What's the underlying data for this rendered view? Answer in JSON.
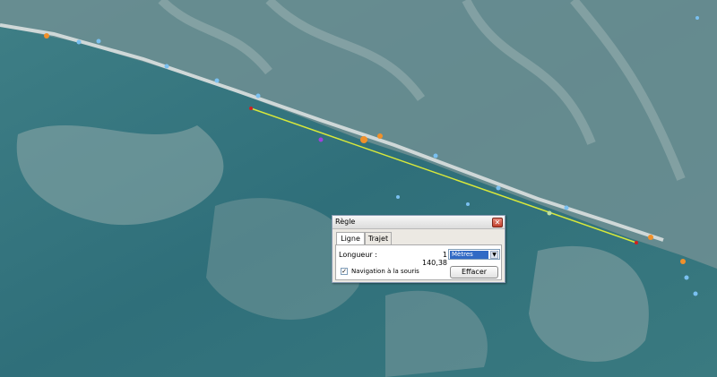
{
  "dialog": {
    "title": "Règle",
    "close_icon": "close-icon",
    "tabs": [
      {
        "label": "Ligne",
        "active": true
      },
      {
        "label": "Trajet",
        "active": false
      }
    ],
    "length_label": "Longueur :",
    "length_value": "1 140,38",
    "unit_selected": "Mètres",
    "mouse_nav_label": "Navigation à la souris",
    "mouse_nav_checked": true,
    "clear_button": "Effacer"
  },
  "map": {
    "measure_line_color": "#d8e83a",
    "accent": "#316ac5"
  }
}
